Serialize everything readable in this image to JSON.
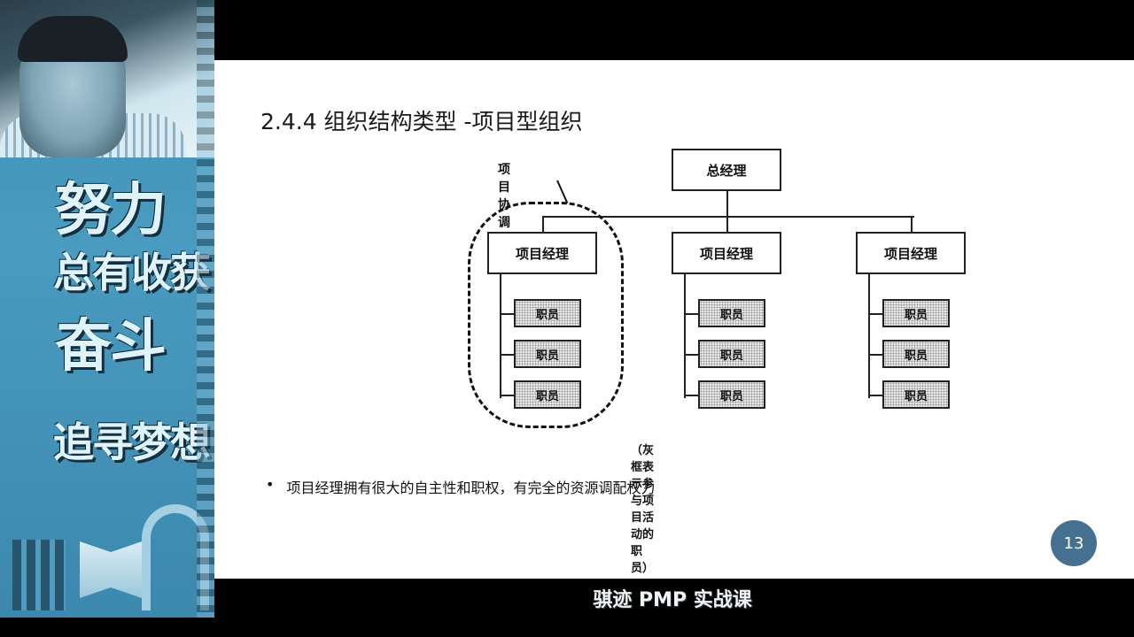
{
  "left_poster": {
    "slogan_line1": "努力",
    "slogan_line2": "总有收获",
    "slogan_line3": "奋斗",
    "slogan_line4": "追寻梦想"
  },
  "slide": {
    "title": "2.4.4 组织结构类型 -项目型组织",
    "org_chart": {
      "top": "总经理",
      "managers": [
        "项目经理",
        "项目经理",
        "项目经理"
      ],
      "staff_label": "职员",
      "coordination_label": "项目协调",
      "legend_note": "（灰框表示参与项目活动的职员）"
    },
    "bullet_marker": "•",
    "bullet": "项目经理拥有很大的自主性和职权，有完全的资源调配权力",
    "page_number": "13"
  },
  "caption": "骐迹 PMP 实战课",
  "colors": {
    "poster_blue": "#4a9bc0",
    "badge": "#46708f",
    "staff_fill": "#e6e6e6"
  }
}
